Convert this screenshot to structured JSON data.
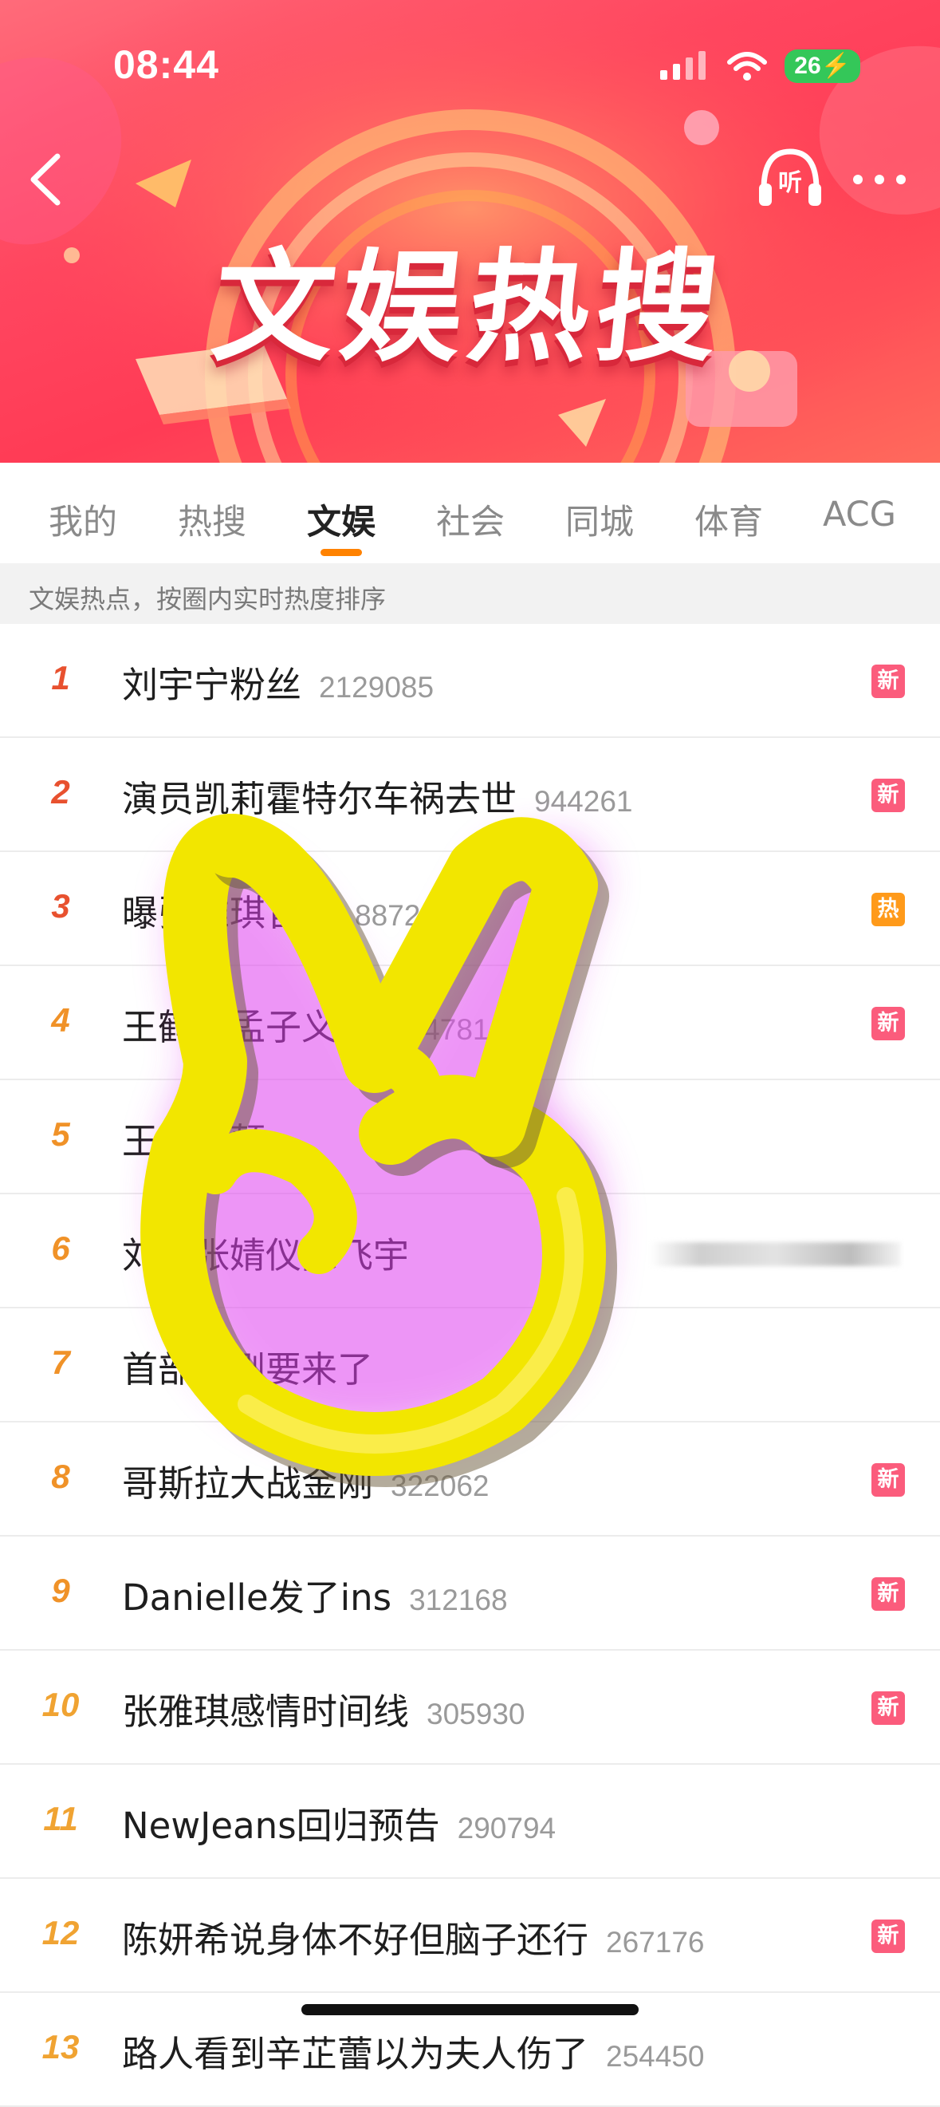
{
  "status_bar": {
    "time": "08:44",
    "battery": "26"
  },
  "header": {
    "title": "文娱热搜",
    "listen_label": "听",
    "colors": {
      "banner": "#ff4660",
      "accent": "#ff8200"
    }
  },
  "tabs": [
    {
      "label": "我的",
      "active": false
    },
    {
      "label": "热搜",
      "active": false
    },
    {
      "label": "文娱",
      "active": true
    },
    {
      "label": "社会",
      "active": false
    },
    {
      "label": "同城",
      "active": false
    },
    {
      "label": "体育",
      "active": false
    },
    {
      "label": "ACG",
      "active": false
    }
  ],
  "subtitle": "文娱热点，按圈内实时热度排序",
  "list": [
    {
      "rank": "1",
      "topic": "刘宇宁粉丝",
      "heat": "2129085",
      "badge": "新",
      "badge_type": "new"
    },
    {
      "rank": "2",
      "topic": "演员凯莉霍特尔车祸去世",
      "heat": "944261",
      "badge": "新",
      "badge_type": "new"
    },
    {
      "rank": "3",
      "topic": "曝张雅琪官宣",
      "heat": "887221",
      "badge": "热",
      "badge_type": "hot"
    },
    {
      "rank": "4",
      "topic": "王鹤棣孟子义吻",
      "heat": "824781",
      "badge": "新",
      "badge_type": "new"
    },
    {
      "rank": "5",
      "topic": "王源好颠",
      "heat": "",
      "badge": "",
      "badge_type": ""
    },
    {
      "rank": "6",
      "topic": "刘锤张婧仪陈飞宇",
      "heat": "",
      "badge": "",
      "badge_type": ""
    },
    {
      "rank": "7",
      "topic": "首部长剧要来了",
      "heat": "",
      "badge": "",
      "badge_type": ""
    },
    {
      "rank": "8",
      "topic": "哥斯拉大战金刚",
      "heat": "322062",
      "badge": "新",
      "badge_type": "new"
    },
    {
      "rank": "9",
      "topic": "Danielle发了ins",
      "heat": "312168",
      "badge": "新",
      "badge_type": "new"
    },
    {
      "rank": "10",
      "topic": "张雅琪感情时间线",
      "heat": "305930",
      "badge": "新",
      "badge_type": "new"
    },
    {
      "rank": "11",
      "topic": "NewJeans回归预告",
      "heat": "290794",
      "badge": "",
      "badge_type": ""
    },
    {
      "rank": "12",
      "topic": "陈妍希说身体不好但脑子还行",
      "heat": "267176",
      "badge": "新",
      "badge_type": "new"
    },
    {
      "rank": "13",
      "topic": "路人看到辛芷蕾以为夫人伤了",
      "heat": "254450",
      "badge": "",
      "badge_type": ""
    }
  ],
  "overlay": {
    "icon": "victory-hand-icon"
  }
}
